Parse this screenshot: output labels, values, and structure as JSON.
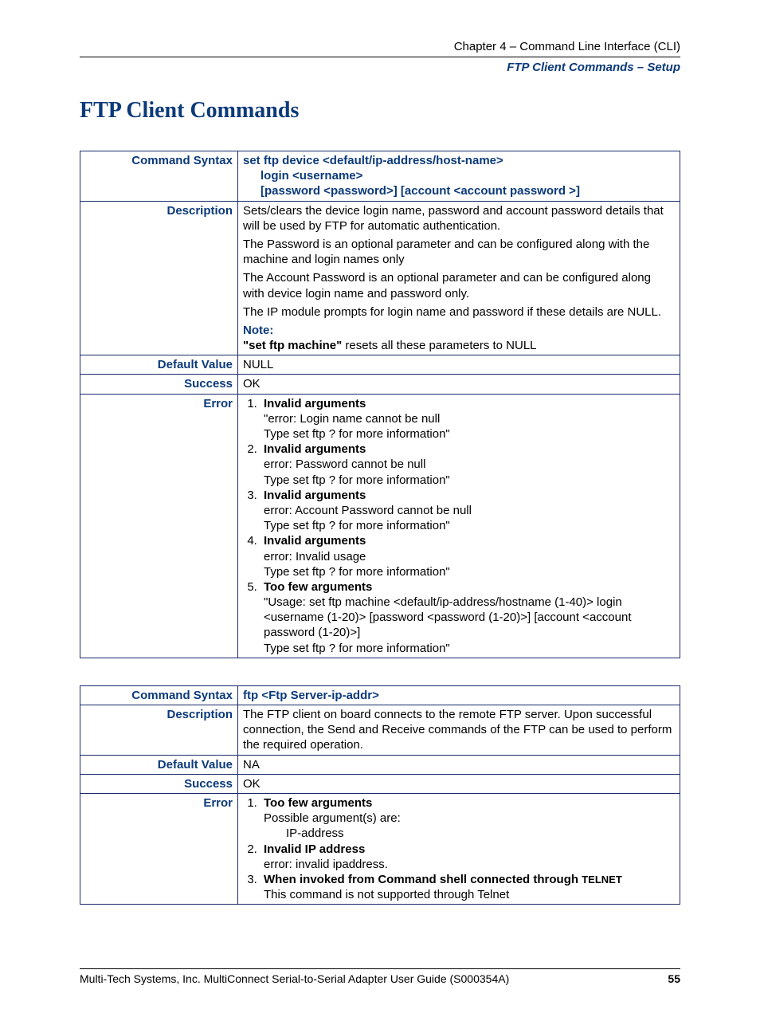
{
  "header": {
    "chapter": "Chapter 4 – Command Line Interface (CLI)",
    "subheader": "FTP Client Commands – Setup"
  },
  "title": "FTP Client Commands",
  "labels": {
    "command_syntax": "Command Syntax",
    "description": "Description",
    "default_value": "Default Value",
    "success": "Success",
    "error": "Error"
  },
  "table1": {
    "syntax_line1": "set ftp device <default/ip-address/host-name>",
    "syntax_line2": "login <username>",
    "syntax_line3": "[password <password>] [account <account password >]",
    "desc_p1": "Sets/clears the device login name, password and account password details that will be used by FTP for automatic authentication.",
    "desc_p2": "The Password is an optional parameter and can be configured along with the machine and login names only",
    "desc_p3": "The Account Password is an optional parameter and can be configured along with device login name and password only.",
    "desc_p4": "The IP module prompts for login name and password if these details are NULL.",
    "note_label": "Note:",
    "note_bold": "\"set ftp machine\"",
    "note_rest": " resets all these parameters to NULL",
    "default_value": "NULL",
    "success": "OK",
    "errors": [
      {
        "head": "Invalid arguments",
        "lines": [
          "\"error: Login name cannot be null",
          "Type set ftp ? for more information\""
        ]
      },
      {
        "head": "Invalid arguments",
        "lines": [
          "error: Password cannot be null",
          "Type set ftp ? for more information\""
        ]
      },
      {
        "head": "Invalid arguments",
        "lines": [
          "error: Account Password cannot be null",
          "Type set ftp ? for more information\""
        ]
      },
      {
        "head": "Invalid arguments",
        "lines": [
          "error: Invalid usage",
          "Type set ftp ? for more information\""
        ]
      },
      {
        "head": "Too few arguments",
        "lines": [
          "\"Usage: set ftp machine <default/ip-address/hostname (1-40)> login <username (1-20)> [password <password (1-20)>] [account <account password (1-20)>]",
          "Type set ftp ? for more information\""
        ]
      }
    ]
  },
  "table2": {
    "syntax": "ftp <Ftp Server-ip-addr>",
    "description": "The FTP client on board connects to the remote FTP server. Upon successful connection, the Send and Receive commands of the FTP can be used to perform the required operation.",
    "default_value": "NA",
    "success": "OK",
    "err1_head": "Too few arguments",
    "err1_l1": "Possible argument(s) are:",
    "err1_l2": "IP-address",
    "err2_head": "Invalid IP address",
    "err2_l1": "error: invalid ipaddress.",
    "err3_head_pre": "When invoked from Command shell connected through ",
    "err3_head_telnet": "TELNET",
    "err3_l1": "This command is not supported through Telnet"
  },
  "footer": {
    "text": "Multi-Tech Systems, Inc. MultiConnect Serial-to-Serial Adapter User Guide (S000354A)",
    "page": "55"
  }
}
